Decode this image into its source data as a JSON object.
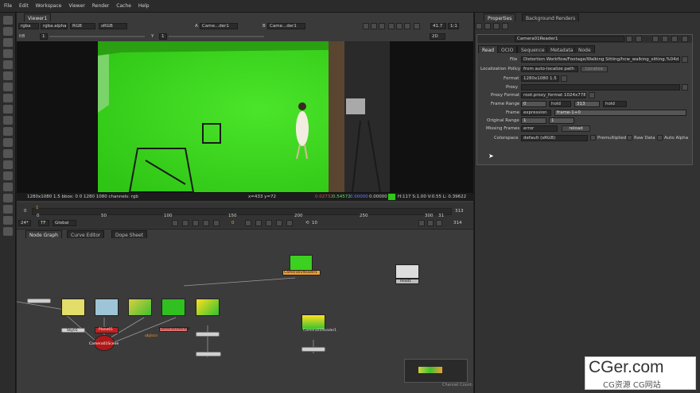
{
  "menu": [
    "File",
    "Edit",
    "Workspace",
    "Viewer",
    "Render",
    "Cache",
    "Help"
  ],
  "viewer": {
    "tab": "Viewer1",
    "channels": "rgba",
    "alpha": "rgba.alpha",
    "colorspace_rgb": "RGB",
    "view_transform": "sRGB",
    "input_a_label": "A",
    "input_a": "Came...der1",
    "input_b_label": "B",
    "input_b": "Came...der1",
    "gain_label": "f/8",
    "gain_value": "1",
    "gamma_label": "Y",
    "gamma_value": "1",
    "zoom": "41.7",
    "proxy": "1:1",
    "mode_2d": "2D",
    "status_left": "1280x1080 1.5   bbox: 0 0 1280 1080 channels: rgb",
    "coords": "x=433 y=72",
    "pix_r": "0.02732",
    "pix_g": "0.54572",
    "pix_b": "0.00000",
    "pix_a": "0.00000",
    "pix_hsv": "H:117 S:1.00 V:0.55   L: 0.39622"
  },
  "timeline": {
    "fps": "24*",
    "tf": "TF",
    "global": "Global",
    "frame_current": "0",
    "increment": "10",
    "start": "0",
    "end_top": "313",
    "end_bottom": "314",
    "ticks": [
      "0",
      "50",
      "100",
      "150",
      "200",
      "250",
      "300",
      "31"
    ],
    "current_marker": "1"
  },
  "graph_tabs": [
    "Node Graph",
    "Curve Editor",
    "Dope Sheet"
  ],
  "nodes": {
    "reader_top": "Camera01Reader1",
    "read1": "Read1",
    "camera01scene": "Camera01Scene",
    "plane01": "Plane01",
    "sky": "Sky01",
    "reader_mid": "Camera01Reader1",
    "camera02": "Camera02Reader1",
    "camera01render": "Camera01Render",
    "objscn": "obj/scn"
  },
  "properties": {
    "tabs": [
      "Properties",
      "Background Renders"
    ],
    "node_name": "Camera01Reader1",
    "subtabs": [
      "Read",
      "OCIO",
      "Sequence",
      "Metadata",
      "Node"
    ],
    "file_label": "File",
    "file": "Distortion Workflow/Footage/Walking Sitting/hcw_walking_sitting.%04d.png",
    "local_label": "Localization Policy",
    "local_value": "from auto-localize path",
    "local_btn": "Localize",
    "format_label": "Format",
    "format_value": "1280x1080 1.5",
    "proxy_label": "Proxy",
    "proxyfmt_label": "Proxy Format",
    "proxyfmt_value": "root.proxy_format 1024x778",
    "framerange_label": "Frame Range",
    "fr_start": "0",
    "fr_start_mode": "hold",
    "fr_end": "313",
    "fr_end_mode": "hold",
    "frame_label": "Frame",
    "frame_mode": "expression",
    "frame_expr": "frame-1+0",
    "orig_label": "Original Range",
    "orig_start": "1",
    "orig_end": "1",
    "missing_label": "Missing Frames",
    "missing_value": "error",
    "reload": "reload",
    "colorspace_label": "Colorspace",
    "colorspace_value": "default (sRGB)",
    "premult": "Premultiplied",
    "raw": "Raw Data",
    "autoalpha": "Auto Alpha"
  },
  "status_bar": "Channel Count: 19  Localization Mode: On  Memory: 0.7 GB (5.1%)  CPU: 74.1%  Disk: 0.0 MB/s",
  "watermark": {
    "main": "CGer.com",
    "sub": "CG资源 CG网站"
  },
  "colors": {
    "green_screen": "#40d820",
    "accent_orange": "#f0a030",
    "scene_red": "#b01818"
  }
}
